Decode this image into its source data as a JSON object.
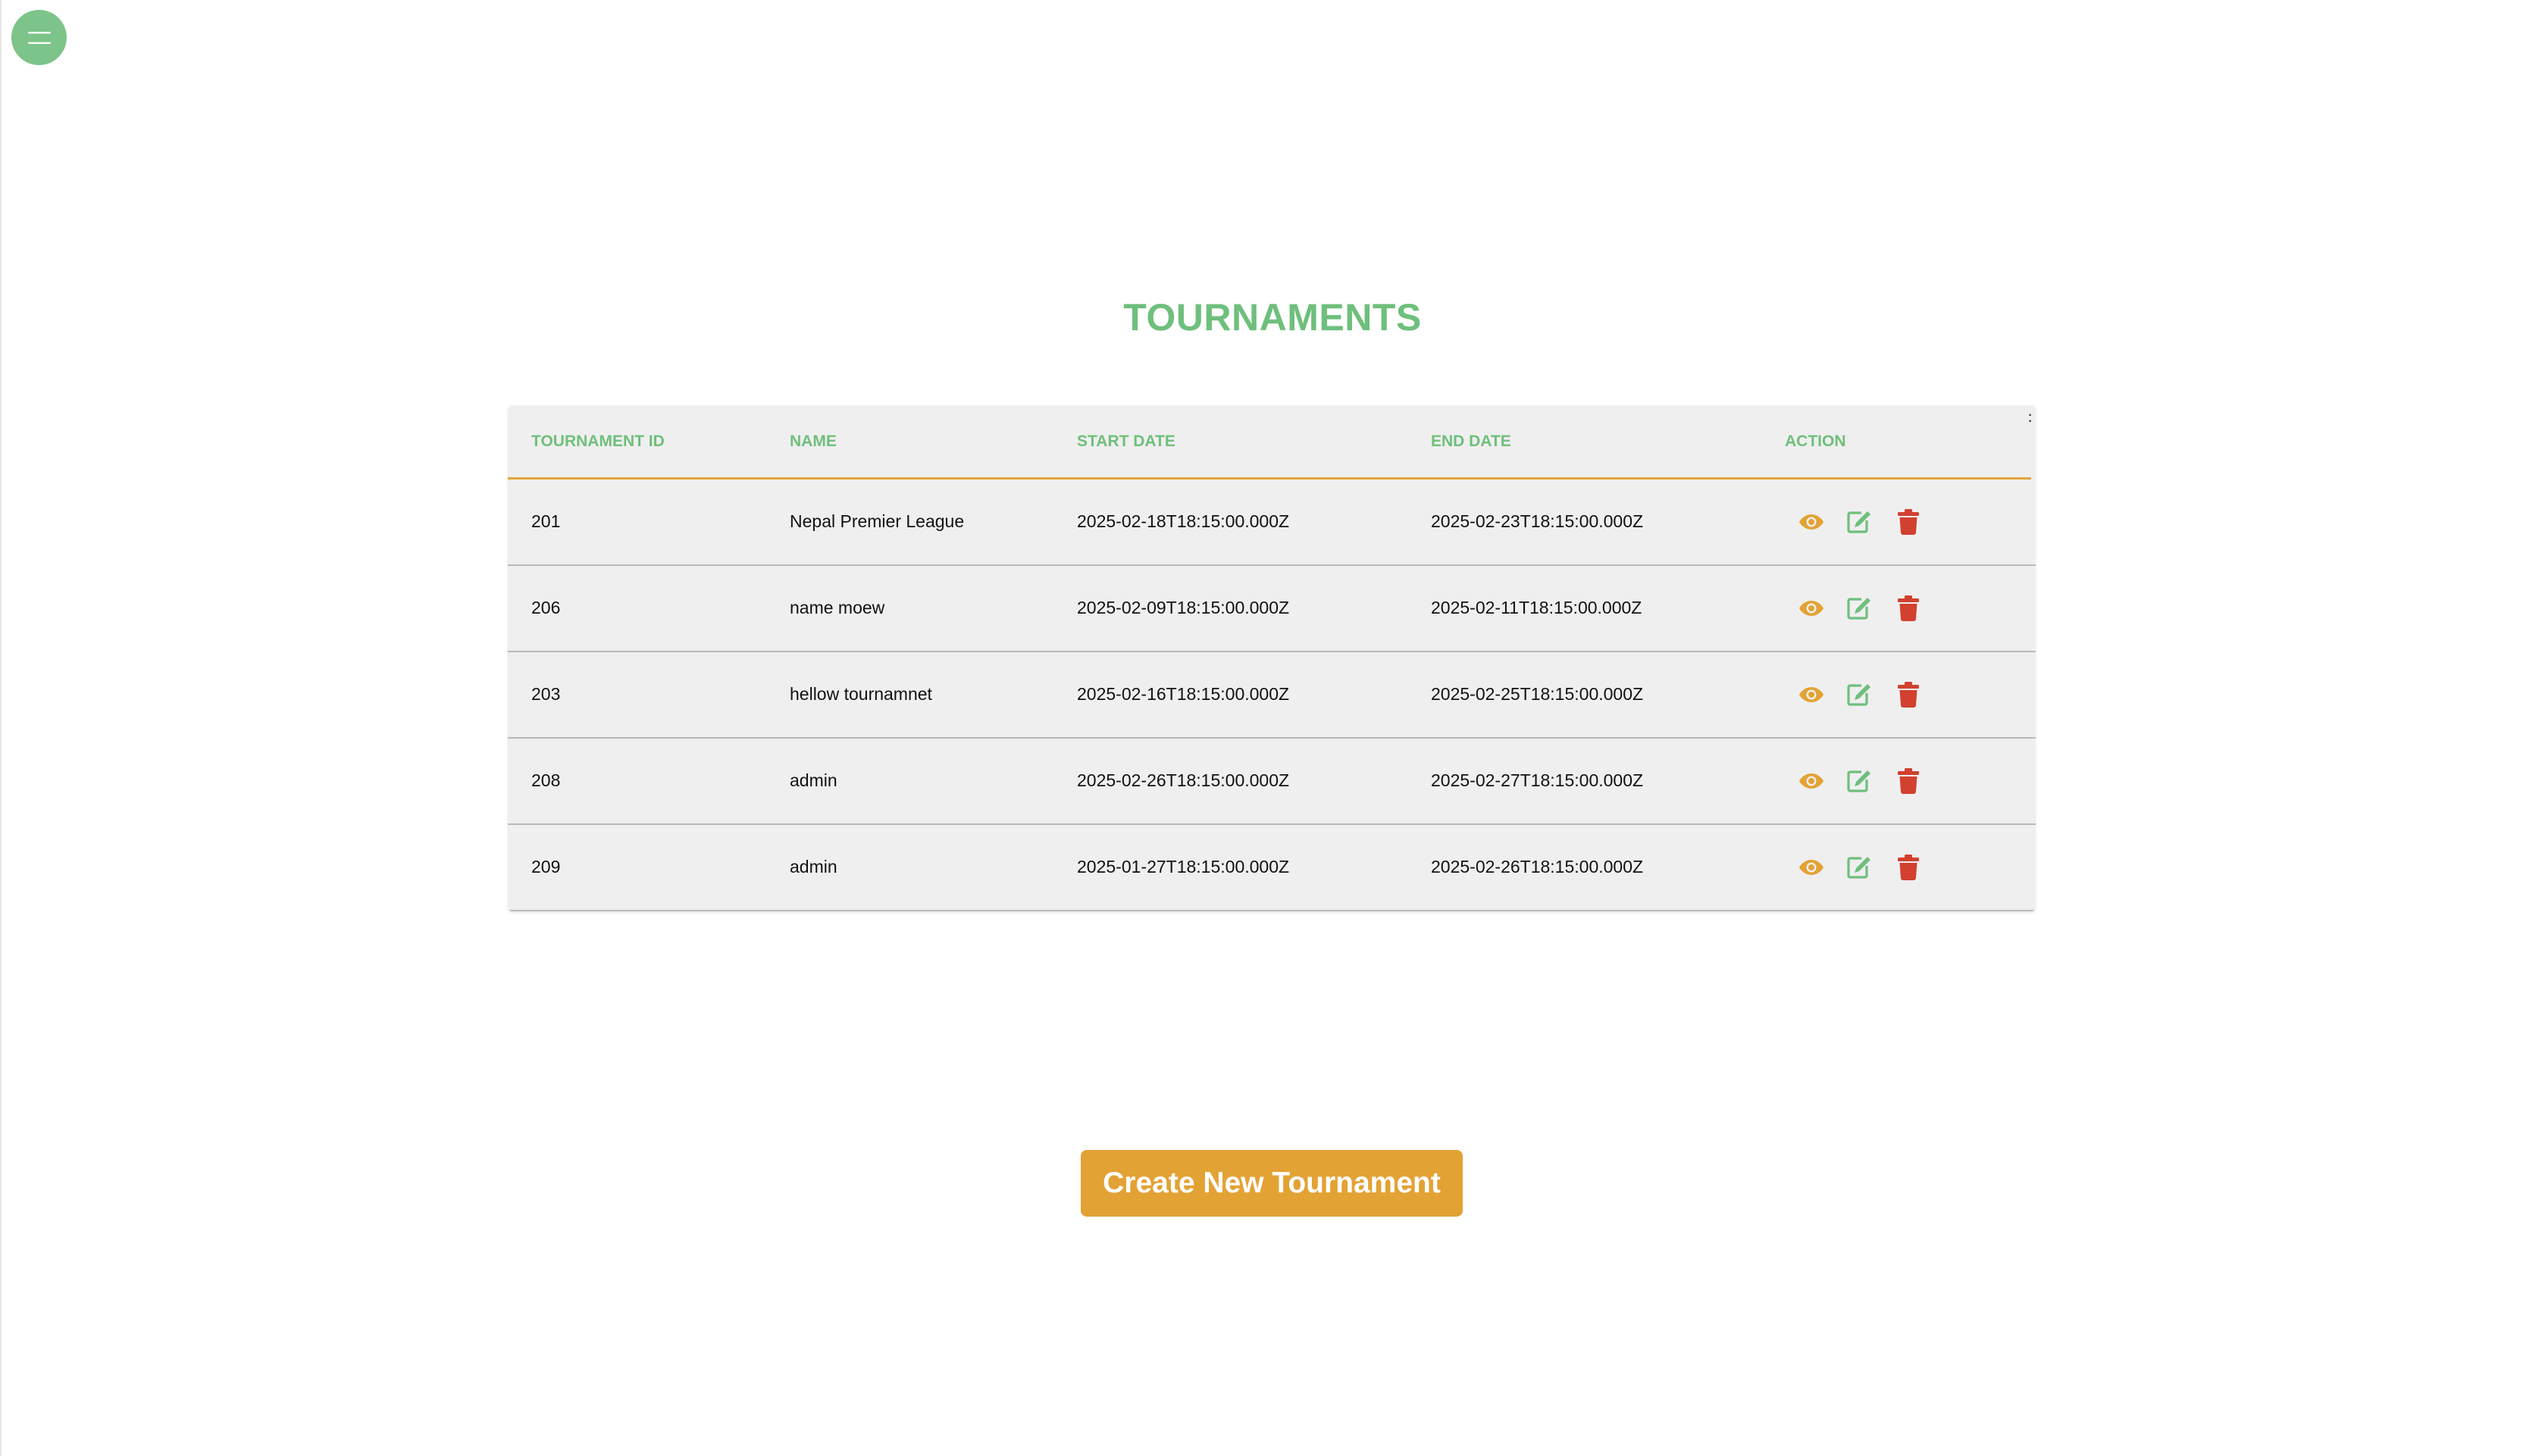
{
  "page": {
    "title": "TOURNAMENTS"
  },
  "menu": {
    "icon": "hamburger-icon",
    "color": "#7cc48a"
  },
  "table": {
    "headers": {
      "id": "TOURNAMENT ID",
      "name": "NAME",
      "start": "START DATE",
      "end": "END DATE",
      "action": "ACTION"
    },
    "scroll_indicator": ":",
    "rows": [
      {
        "id": "201",
        "name": "Nepal Premier League",
        "start": "2025-02-18T18:15:00.000Z",
        "end": "2025-02-23T18:15:00.000Z"
      },
      {
        "id": "206",
        "name": "name moew",
        "start": "2025-02-09T18:15:00.000Z",
        "end": "2025-02-11T18:15:00.000Z"
      },
      {
        "id": "203",
        "name": "hellow tournamnet",
        "start": "2025-02-16T18:15:00.000Z",
        "end": "2025-02-25T18:15:00.000Z"
      },
      {
        "id": "208",
        "name": "admin",
        "start": "2025-02-26T18:15:00.000Z",
        "end": "2025-02-27T18:15:00.000Z"
      },
      {
        "id": "209",
        "name": "admin",
        "start": "2025-01-27T18:15:00.000Z",
        "end": "2025-02-26T18:15:00.000Z"
      }
    ],
    "action_icons": [
      "eye-icon",
      "edit-icon",
      "trash-icon"
    ]
  },
  "create_button": {
    "label": "Create New Tournament"
  },
  "colors": {
    "accent_green": "#6fbf7c",
    "accent_orange": "#e3a234",
    "delete_red": "#d2402f",
    "table_bg": "#efefef"
  }
}
